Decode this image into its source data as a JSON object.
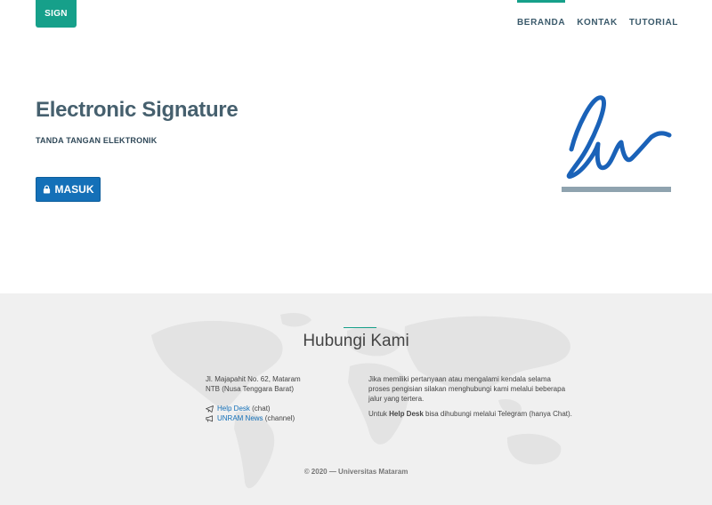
{
  "header": {
    "brand": "SIGN",
    "nav": [
      {
        "label": "BERANDA",
        "active": true
      },
      {
        "label": "KONTAK",
        "active": false
      },
      {
        "label": "TUTORIAL",
        "active": false
      }
    ]
  },
  "hero": {
    "title": "Electronic Signature",
    "subtitle": "TANDA TANGAN ELEKTRONIK",
    "login_label": "MASUK",
    "login_icon": "lock-icon"
  },
  "footer": {
    "title": "Hubungi Kami",
    "address_line1": "Jl. Majapahit No. 62, Mataram",
    "address_line2": "NTB (Nusa Tenggara Barat)",
    "helpdesk_link": "Help Desk",
    "helpdesk_suffix": " (chat)",
    "news_link": "UNRAM News",
    "news_suffix": " (channel)",
    "info_text": "Jika memiliki pertanyaan atau mengalami kendala selama proses pengisian silakan menghubungi kami melalui beberapa jalur yang tertera.",
    "helpdesk_note_prefix": "Untuk ",
    "helpdesk_note_bold": "Help Desk",
    "helpdesk_note_suffix": " bisa dihubungi melalui Telegram (hanya Chat).",
    "copyright": "© 2020 — Universitas Mataram"
  },
  "colors": {
    "accent": "#16a08a",
    "primary": "#1470b8",
    "heading": "#46606e"
  }
}
